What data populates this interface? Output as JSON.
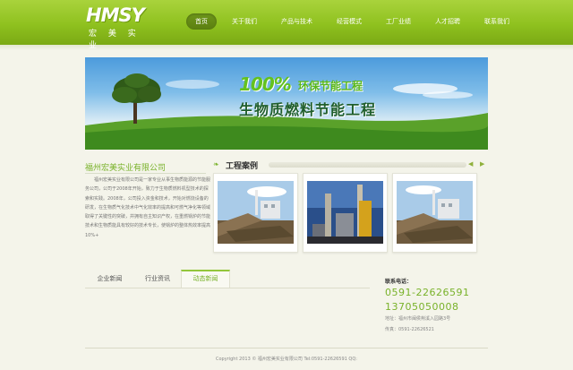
{
  "header": {
    "logo_mark": "HMSY",
    "logo_sub": "宏 美 实 业",
    "nav": [
      "首页",
      "关于我们",
      "产品与技术",
      "经营模式",
      "工厂业绩",
      "人才招聘",
      "联系我们"
    ]
  },
  "banner": {
    "pct": "100%",
    "line1": "环保节能工程",
    "line2": "生物质燃料节能工程"
  },
  "company": {
    "title": "福州宏美实业有限公司",
    "intro": "福州宏美实业有限公司是一家专业从事生物质能源的节能服务公司，公司于2008年开始，致力于生物质燃料机型技术的探索和实践。2008年，公司投入资金和技术，开始对燃烧设备的研发，在生物质气化技术中气化效率的提高和可燃气净化等领域取得了关键性的突破，并拥有自主知识产权，在重燃锅炉的节能技术和生物质能具有较好的技术专长，使锅炉的整体热效率提高10%+"
  },
  "cases": {
    "icon": "leaf-icon",
    "title": "工程案例",
    "prev": "◀",
    "next": "▶"
  },
  "tabs": [
    "企业新闻",
    "行业资讯",
    "动态新闻"
  ],
  "contact": {
    "label": "联系电话：",
    "phone1": "0591-22626591",
    "phone2": "13705050008",
    "address": "地址：福州市闽侯荆溪入园路3号",
    "fax": "传真：0591-22626521"
  },
  "footer": {
    "copyright": "Copyright 2013 © 福州宏美实业有限公司 Tel:0591-22626591 QQ:"
  },
  "colors": {
    "accent": "#79b22a",
    "header": "#8fc11f",
    "nav_active": "#5b7f10"
  }
}
